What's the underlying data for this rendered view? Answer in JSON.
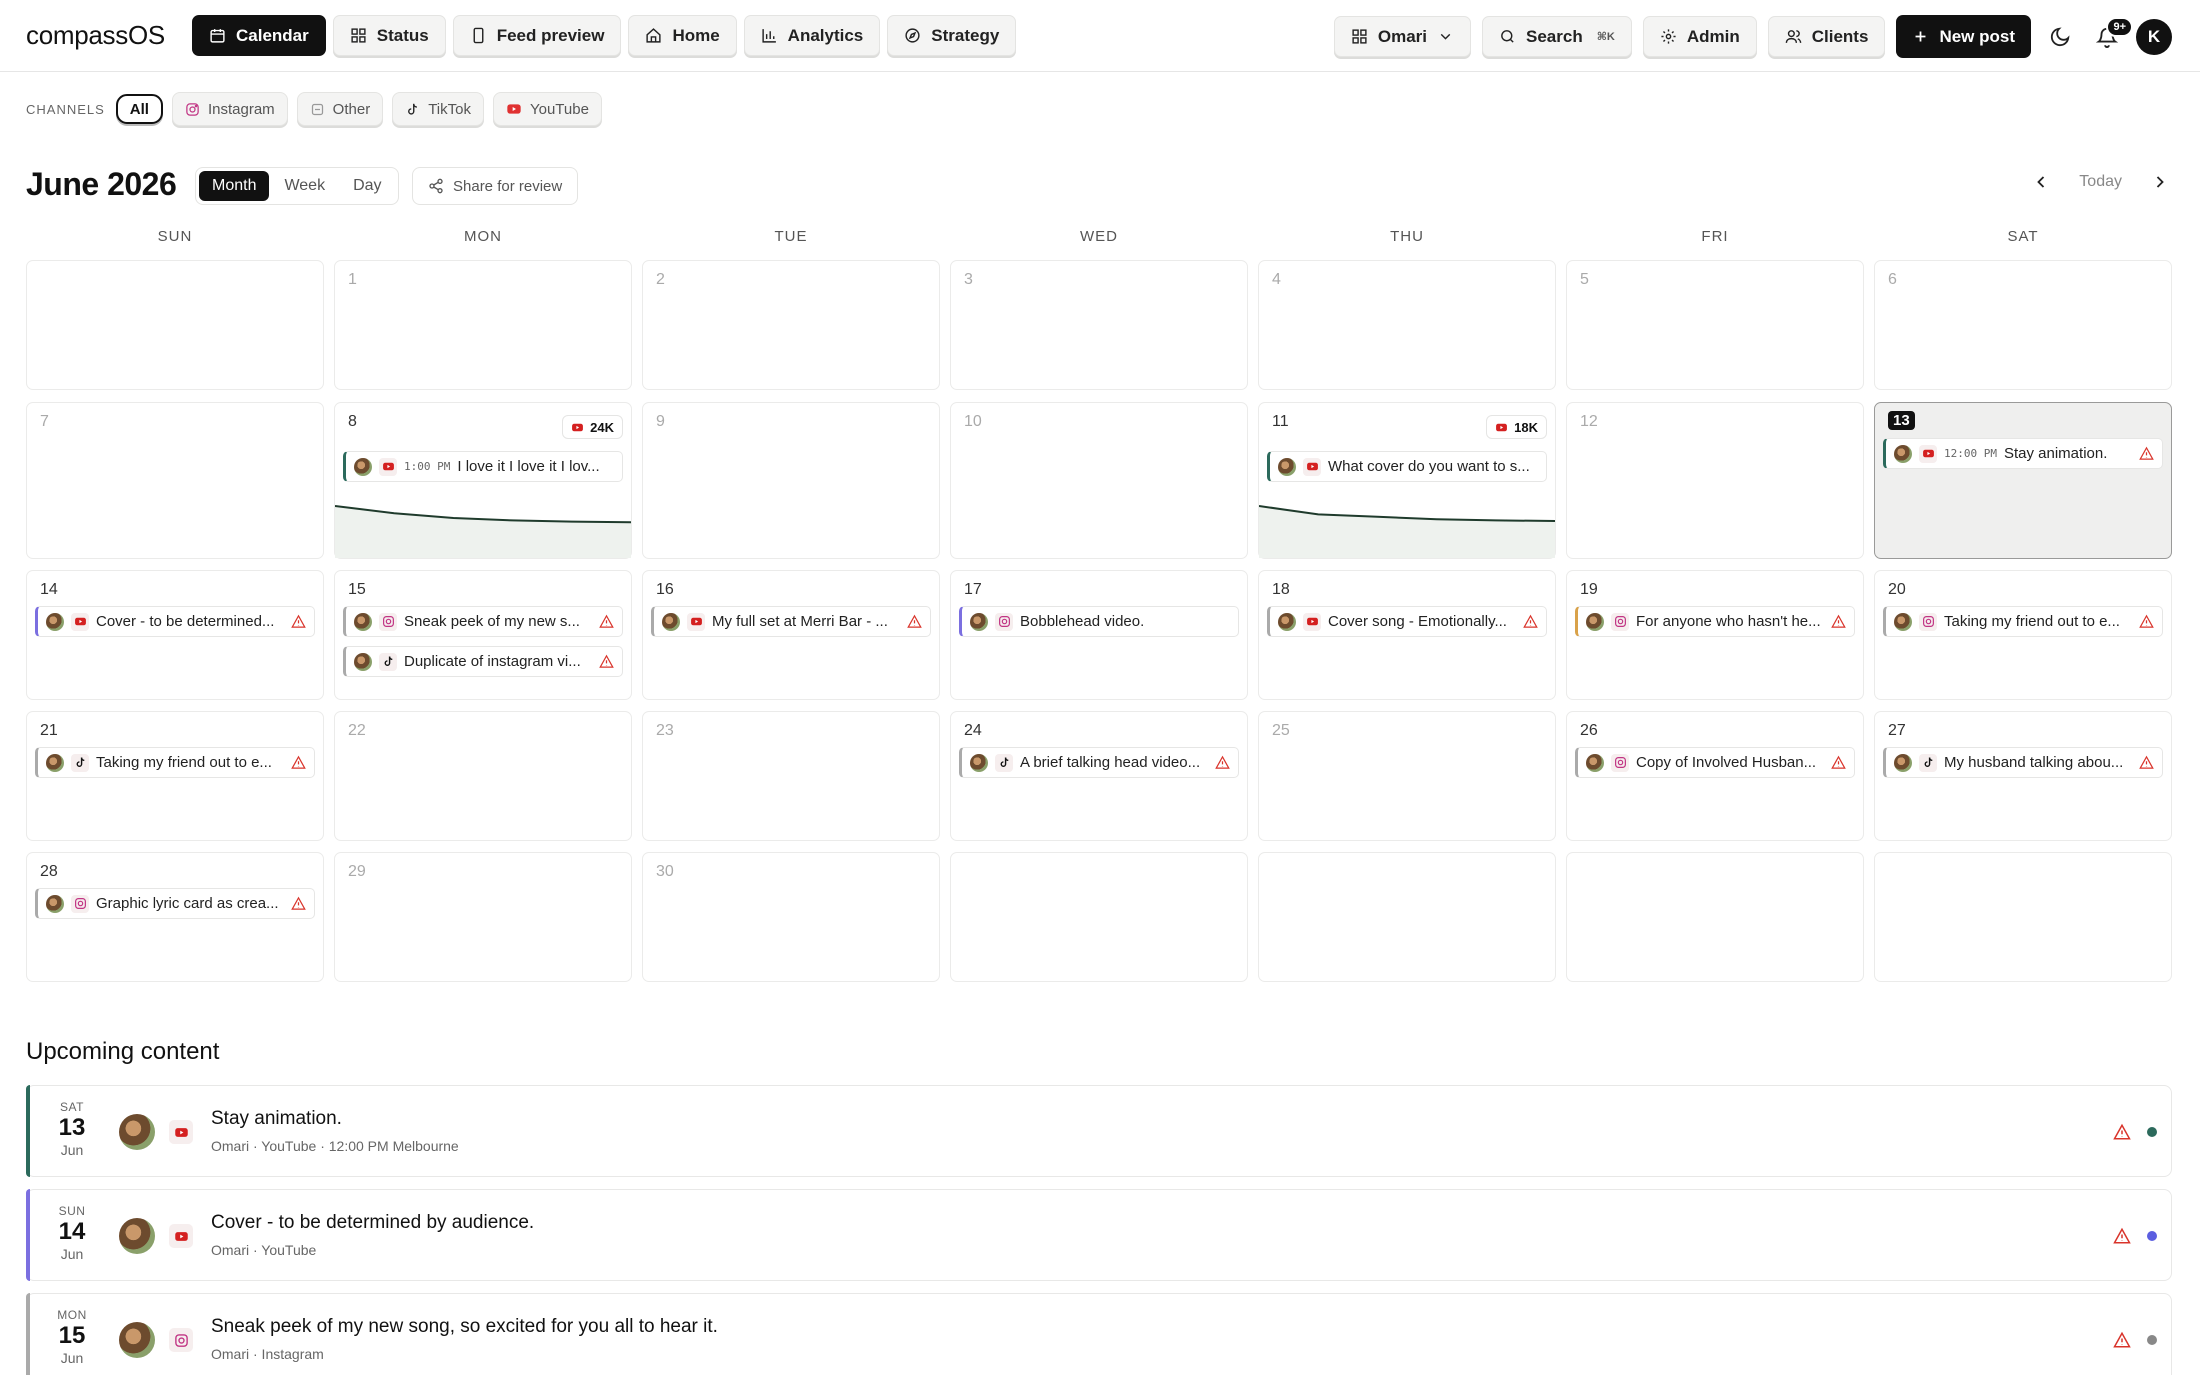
{
  "app": {
    "brand": "compassOS"
  },
  "nav": [
    {
      "label": "Calendar",
      "icon": "calendar-icon",
      "active": true
    },
    {
      "label": "Status",
      "icon": "grid-icon"
    },
    {
      "label": "Feed preview",
      "icon": "phone-icon"
    },
    {
      "label": "Home",
      "icon": "home-icon"
    },
    {
      "label": "Analytics",
      "icon": "bar-chart-icon"
    },
    {
      "label": "Strategy",
      "icon": "compass-icon"
    }
  ],
  "right_nav": {
    "workspace": "Omari",
    "search": "Search",
    "search_shortcut": "⌘K",
    "admin": "Admin",
    "clients": "Clients",
    "new_post": "New post",
    "notifications": "9+",
    "avatar": "K"
  },
  "channels": {
    "label": "CHANNELS",
    "items": [
      {
        "label": "All",
        "active": true
      },
      {
        "label": "Instagram",
        "icon": "instagram-icon"
      },
      {
        "label": "Other",
        "icon": "other-icon"
      },
      {
        "label": "TikTok",
        "icon": "tiktok-icon"
      },
      {
        "label": "YouTube",
        "icon": "youtube-icon"
      }
    ]
  },
  "calendar": {
    "title": "June 2026",
    "views": [
      "Month",
      "Week",
      "Day"
    ],
    "active_view": "Month",
    "share": "Share for review",
    "today": "Today",
    "weekdays": [
      "SUN",
      "MON",
      "TUE",
      "WED",
      "THU",
      "FRI",
      "SAT"
    ],
    "today_day": 13,
    "days": [
      {
        "day": "1"
      },
      {
        "day": "2"
      },
      {
        "day": "3"
      },
      {
        "day": "4"
      },
      {
        "day": "5"
      },
      {
        "day": "6"
      },
      {
        "day": "7"
      },
      {
        "day": "8",
        "stat": "24K",
        "spark": [
          0.0,
          0.12,
          0.2,
          0.24,
          0.26,
          0.27
        ],
        "posts": [
          {
            "time": "1:00 PM",
            "text": "I love it I love it I lov...",
            "platform": "youtube",
            "color": "green",
            "warn": false
          }
        ]
      },
      {
        "day": "9"
      },
      {
        "day": "10"
      },
      {
        "day": "11",
        "stat": "18K",
        "spark": [
          0.0,
          0.14,
          0.18,
          0.22,
          0.24,
          0.25
        ],
        "posts": [
          {
            "text": "What cover do you want to s...",
            "platform": "youtube",
            "color": "green",
            "warn": false
          }
        ]
      },
      {
        "day": "12"
      },
      {
        "day": "13",
        "posts": [
          {
            "time": "12:00 PM",
            "text": "Stay animation.",
            "platform": "youtube",
            "color": "green",
            "warn": true
          }
        ]
      },
      {
        "day": "14",
        "posts": [
          {
            "text": "Cover - to be determined...",
            "platform": "youtube",
            "color": "purple",
            "warn": true
          }
        ]
      },
      {
        "day": "15",
        "posts": [
          {
            "text": "Sneak peek of my new s...",
            "platform": "instagram",
            "color": "gray",
            "warn": true
          },
          {
            "text": "Duplicate of instagram vi...",
            "platform": "tiktok",
            "color": "gray",
            "warn": true
          }
        ]
      },
      {
        "day": "16",
        "posts": [
          {
            "text": "My full set at Merri Bar - ...",
            "platform": "youtube",
            "color": "gray",
            "warn": true
          }
        ]
      },
      {
        "day": "17",
        "posts": [
          {
            "text": "Bobblehead video.",
            "platform": "instagram",
            "color": "purple",
            "warn": false
          }
        ]
      },
      {
        "day": "18",
        "posts": [
          {
            "text": "Cover song - Emotionally...",
            "platform": "youtube",
            "color": "gray",
            "warn": true
          }
        ]
      },
      {
        "day": "19",
        "posts": [
          {
            "text": "For anyone who hasn't he...",
            "platform": "instagram",
            "color": "orange",
            "warn": true
          }
        ]
      },
      {
        "day": "20",
        "posts": [
          {
            "text": "Taking my friend out to e...",
            "platform": "instagram",
            "color": "gray",
            "warn": true
          }
        ]
      },
      {
        "day": "21",
        "posts": [
          {
            "text": "Taking my friend out to e...",
            "platform": "tiktok",
            "color": "gray",
            "warn": true
          }
        ]
      },
      {
        "day": "22"
      },
      {
        "day": "23"
      },
      {
        "day": "24",
        "posts": [
          {
            "text": "A brief talking head video...",
            "platform": "tiktok",
            "color": "gray",
            "warn": true
          }
        ]
      },
      {
        "day": "25"
      },
      {
        "day": "26",
        "posts": [
          {
            "text": "Copy of Involved Husban...",
            "platform": "instagram",
            "color": "gray",
            "warn": true
          }
        ]
      },
      {
        "day": "27",
        "posts": [
          {
            "text": "My husband talking abou...",
            "platform": "tiktok",
            "color": "gray",
            "warn": true
          }
        ]
      },
      {
        "day": "28",
        "posts": [
          {
            "text": "Graphic lyric card as crea...",
            "platform": "instagram",
            "color": "gray",
            "warn": true
          }
        ]
      },
      {
        "day": "29"
      },
      {
        "day": "30"
      }
    ]
  },
  "upcoming": {
    "title": "Upcoming content",
    "items": [
      {
        "dow": "SAT",
        "day": "13",
        "mon": "Jun",
        "platform": "youtube",
        "text": "Stay animation.",
        "meta": "Omari · YouTube · 12:00 PM Melbourne",
        "bar": "#2c6a5c",
        "dot": "#2c6a5c"
      },
      {
        "dow": "SUN",
        "day": "14",
        "mon": "Jun",
        "platform": "youtube",
        "text": "Cover - to be determined by audience.",
        "meta": "Omari · YouTube",
        "bar": "#7b6fe0",
        "dot": "#5b5ee0"
      },
      {
        "dow": "MON",
        "day": "15",
        "mon": "Jun",
        "platform": "instagram",
        "text": "Sneak peek of my new song, so excited for you all to hear it.",
        "meta": "Omari · Instagram",
        "bar": "#aaaaaa",
        "dot": "#888888"
      }
    ]
  }
}
